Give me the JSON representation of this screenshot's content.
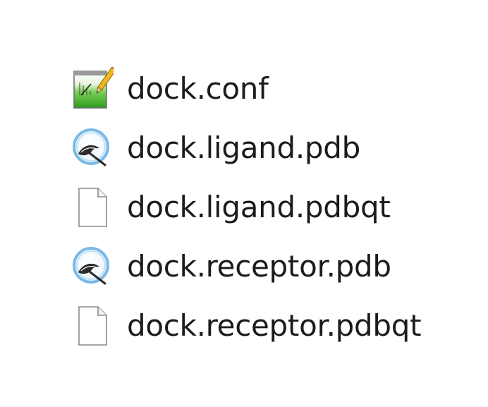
{
  "files": [
    {
      "name": "dock.conf",
      "icon": "notepad-icon"
    },
    {
      "name": "dock.ligand.pdb",
      "icon": "viewer-app-icon"
    },
    {
      "name": "dock.ligand.pdbqt",
      "icon": "blank-file-icon"
    },
    {
      "name": "dock.receptor.pdb",
      "icon": "viewer-app-icon"
    },
    {
      "name": "dock.receptor.pdbqt",
      "icon": "blank-file-icon"
    }
  ],
  "colors": {
    "text": "#1b1b1b",
    "notepad_green": "#3fbf2b",
    "viewer_blue": "#6ab3e6"
  }
}
